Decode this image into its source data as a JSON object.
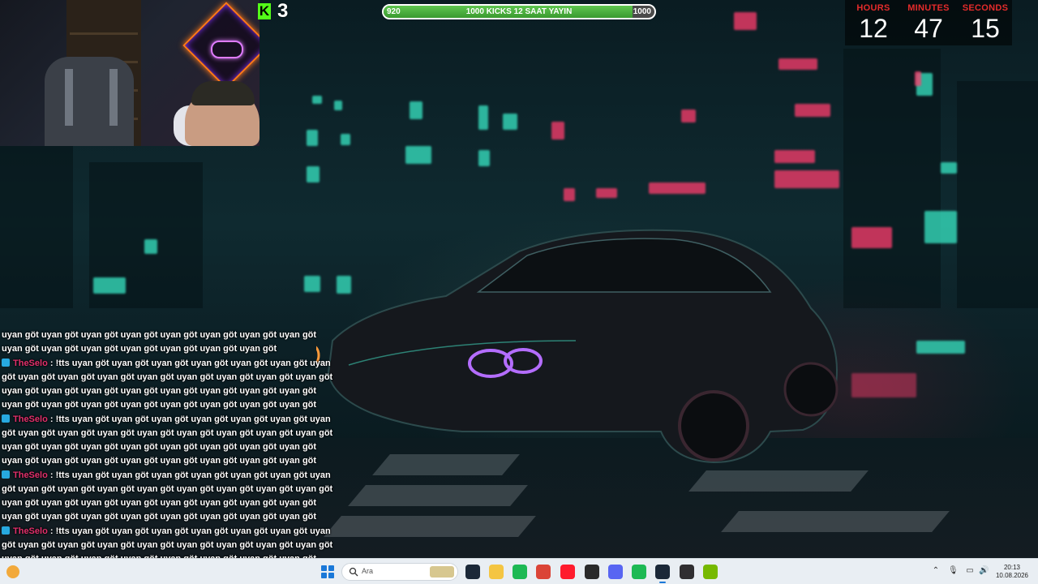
{
  "kick": {
    "count": "3",
    "logo_letter": "K"
  },
  "goal": {
    "min": "920",
    "max": "1000",
    "label": "1000 KICKS 12 SAAT YAYIN",
    "progress": 0.92
  },
  "countdown": {
    "hours_label": "HOURS",
    "hours": "12",
    "minutes_label": "MINUTES",
    "minutes": "47",
    "seconds_label": "SECONDS",
    "seconds": "15"
  },
  "chat": {
    "lines": [
      {
        "user": "",
        "text": "uyan göt uyan göt uyan göt uyan göt uyan göt uyan göt uyan göt uyan göt uyan göt uyan göt uyan göt uyan göt uyan göt uyan göt uyan göt"
      },
      {
        "user": "TheSelo",
        "text": ": !tts uyan göt uyan göt uyan göt uyan göt uyan göt uyan göt uyan göt uyan göt uyan göt uyan göt uyan göt uyan göt uyan göt uyan göt uyan göt uyan göt uyan göt uyan göt uyan göt uyan göt uyan göt uyan göt uyan göt uyan göt uyan göt uyan göt uyan göt uyan göt uyan göt uyan göt uyan göt"
      },
      {
        "user": "TheSelo",
        "text": ": !tts uyan göt uyan göt uyan göt uyan göt uyan göt uyan göt uyan göt uyan göt uyan göt uyan göt uyan göt uyan göt uyan göt uyan göt uyan göt uyan göt uyan göt uyan göt uyan göt uyan göt uyan göt uyan göt uyan göt uyan göt uyan göt uyan göt uyan göt uyan göt uyan göt uyan göt uyan göt"
      },
      {
        "user": "TheSelo",
        "text": ": !tts uyan göt uyan göt uyan göt uyan göt uyan göt uyan göt uyan göt uyan göt uyan göt uyan göt uyan göt uyan göt uyan göt uyan göt uyan göt uyan göt uyan göt uyan göt uyan göt uyan göt uyan göt uyan göt uyan göt uyan göt uyan göt uyan göt uyan göt uyan göt uyan göt uyan göt uyan göt"
      },
      {
        "user": "TheSelo",
        "text": ": !tts uyan göt uyan göt uyan göt uyan göt uyan göt uyan göt uyan göt uyan göt uyan göt uyan göt uyan göt uyan göt uyan göt uyan göt uyan göt uyan göt uyan göt uyan göt uyan göt uyan göt uyan göt uyan göt uyan göt uyan göt uyan göt uyan göt uyan göt uyan göt uyan göt uyan göt uyan göt"
      }
    ]
  },
  "taskbar": {
    "search_placeholder": "Ara",
    "time": "20:13",
    "date": "10.08.2026",
    "apps": [
      {
        "name": "steam-app-icon",
        "color": "#1b2838"
      },
      {
        "name": "file-explorer-icon",
        "color": "#f4c542"
      },
      {
        "name": "spotify-app-icon",
        "color": "#1db954"
      },
      {
        "name": "chrome-app-icon",
        "color": "#db4437"
      },
      {
        "name": "opera-app-icon",
        "color": "#ff1b2d"
      },
      {
        "name": "epic-games-icon",
        "color": "#2a2a2a"
      },
      {
        "name": "discord-app-icon",
        "color": "#5865f2"
      },
      {
        "name": "spotify-alt-icon",
        "color": "#1db954"
      },
      {
        "name": "steam-active-icon",
        "color": "#1b2838"
      },
      {
        "name": "obs-app-icon",
        "color": "#302e31"
      },
      {
        "name": "nvidia-app-icon",
        "color": "#76b900"
      }
    ]
  }
}
